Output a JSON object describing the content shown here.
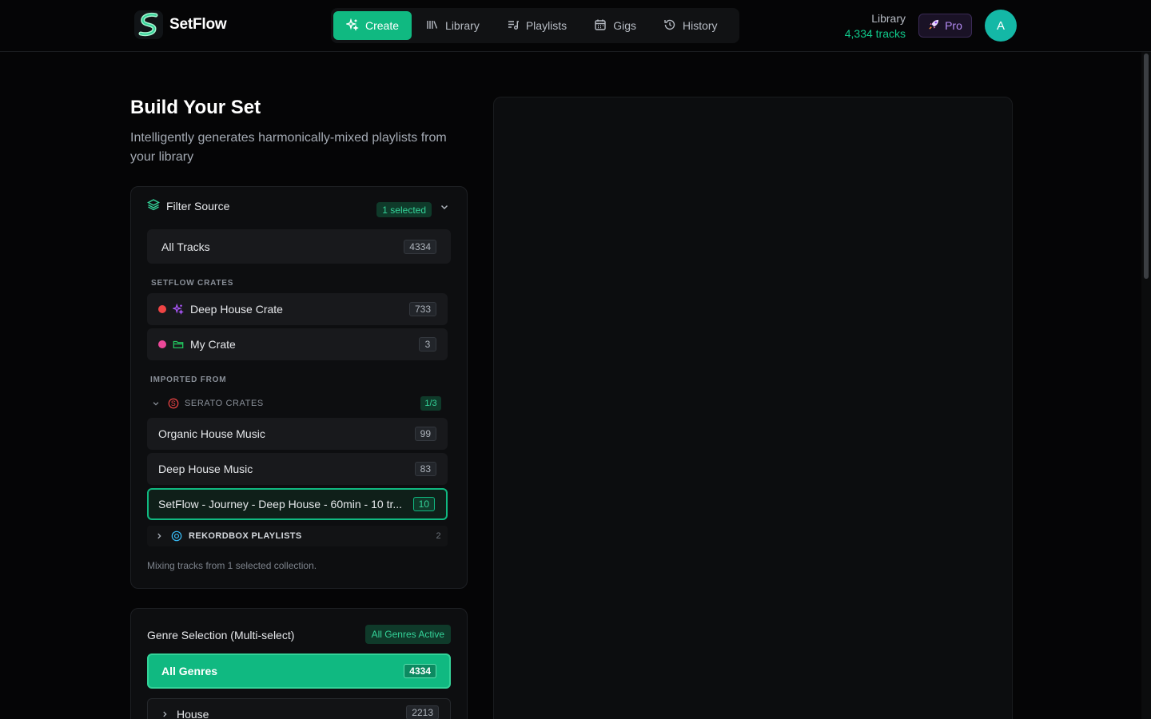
{
  "app": {
    "name": "SetFlow"
  },
  "nav": {
    "items": [
      {
        "label": "Create",
        "icon": "sparkles-icon",
        "active": true
      },
      {
        "label": "Library",
        "icon": "library-icon"
      },
      {
        "label": "Playlists",
        "icon": "playlist-icon"
      },
      {
        "label": "Gigs",
        "icon": "calendar-icon"
      },
      {
        "label": "History",
        "icon": "history-icon"
      }
    ]
  },
  "library_info": {
    "label": "Library",
    "tracks": "4,334 tracks"
  },
  "pro": {
    "label": "Pro",
    "icon": "rocket-icon"
  },
  "user": {
    "initial": "A"
  },
  "page": {
    "title": "Build Your Set",
    "subtitle": "Intelligently generates harmonically-mixed playlists from your library"
  },
  "filter": {
    "title": "Filter Source",
    "selected_badge": "1 selected",
    "all_tracks": {
      "label": "All Tracks",
      "count": "4334"
    },
    "setflow_crates_label": "SETFLOW CRATES",
    "crates": [
      {
        "label": "Deep House Crate",
        "count": "733",
        "dot_color": "#ef4444",
        "icon": "sparkles-icon"
      },
      {
        "label": "My Crate",
        "count": "3",
        "dot_color": "#ec4899",
        "icon": "folder-icon"
      }
    ],
    "imported_label": "IMPORTED FROM",
    "serato": {
      "label": "SERATO CRATES",
      "count": "1/3",
      "items": [
        {
          "label": "Organic House Music",
          "count": "99"
        },
        {
          "label": "Deep House Music",
          "count": "83"
        },
        {
          "label": "SetFlow - Journey - Deep House - 60min - 10 tr...",
          "count": "10",
          "selected": true
        }
      ]
    },
    "rekordbox": {
      "label": "REKORDBOX PLAYLISTS",
      "count": "2"
    },
    "note": "Mixing tracks from 1 selected collection."
  },
  "genre": {
    "title": "Genre Selection (Multi-select)",
    "badge": "All Genres Active",
    "all": {
      "label": "All Genres",
      "count": "4334"
    },
    "items": [
      {
        "label": "House",
        "count": "2213"
      }
    ]
  },
  "colors": {
    "accent": "#10b981",
    "background": "#050506",
    "card": "#0d0e10"
  }
}
